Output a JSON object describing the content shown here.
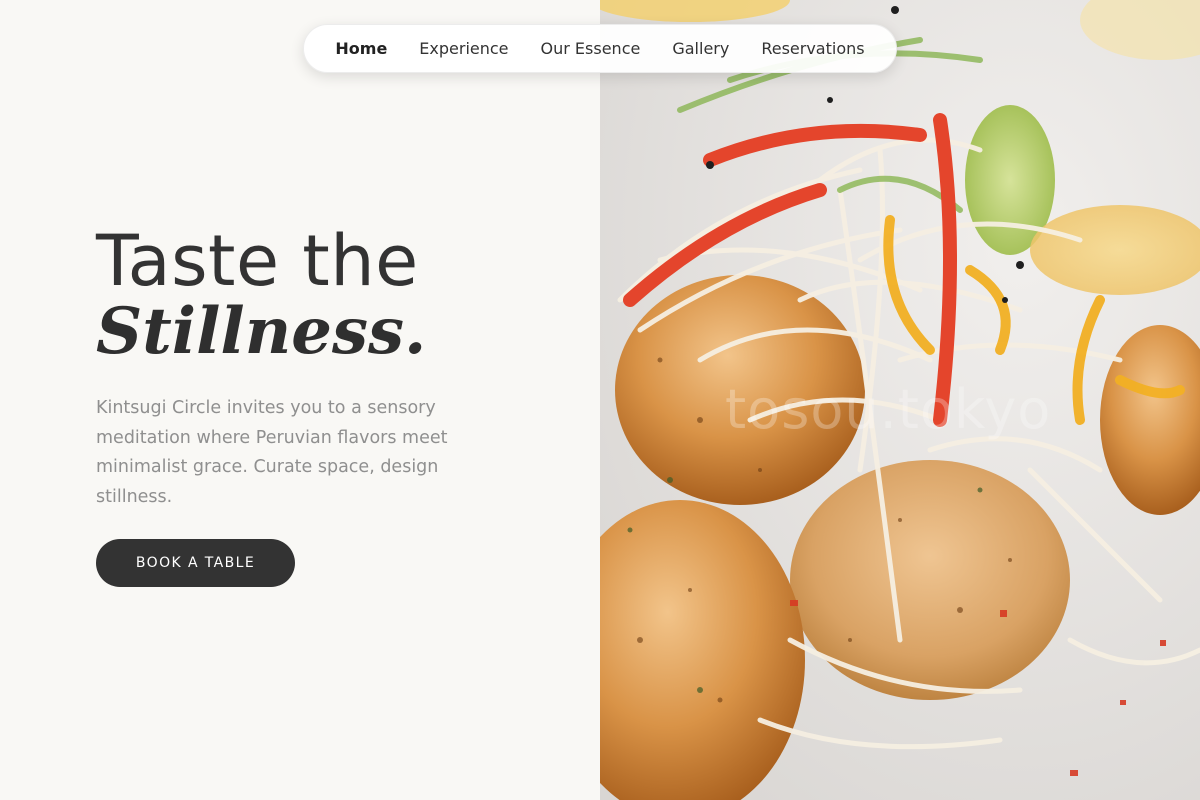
{
  "nav": {
    "items": [
      {
        "label": "Home",
        "active": true
      },
      {
        "label": "Experience",
        "active": false
      },
      {
        "label": "Our Essence",
        "active": false
      },
      {
        "label": "Gallery",
        "active": false
      },
      {
        "label": "Reservations",
        "active": false
      }
    ]
  },
  "hero": {
    "title_line1": "Taste the",
    "title_line2": "Stillness.",
    "description": "Kintsugi Circle invites you to a sensory meditation where Peruvian flavors meet minimalist grace. Curate space, design stillness.",
    "cta_label": "BOOK A TABLE"
  },
  "image": {
    "subject": "fried-croquettes-with-vegetable-slaw",
    "watermark": "tosou.tokyo"
  },
  "colors": {
    "background": "#f9f8f5",
    "text": "#333333",
    "muted_text": "#8f8f8f",
    "button_bg": "#333333",
    "button_text": "#ffffff"
  }
}
